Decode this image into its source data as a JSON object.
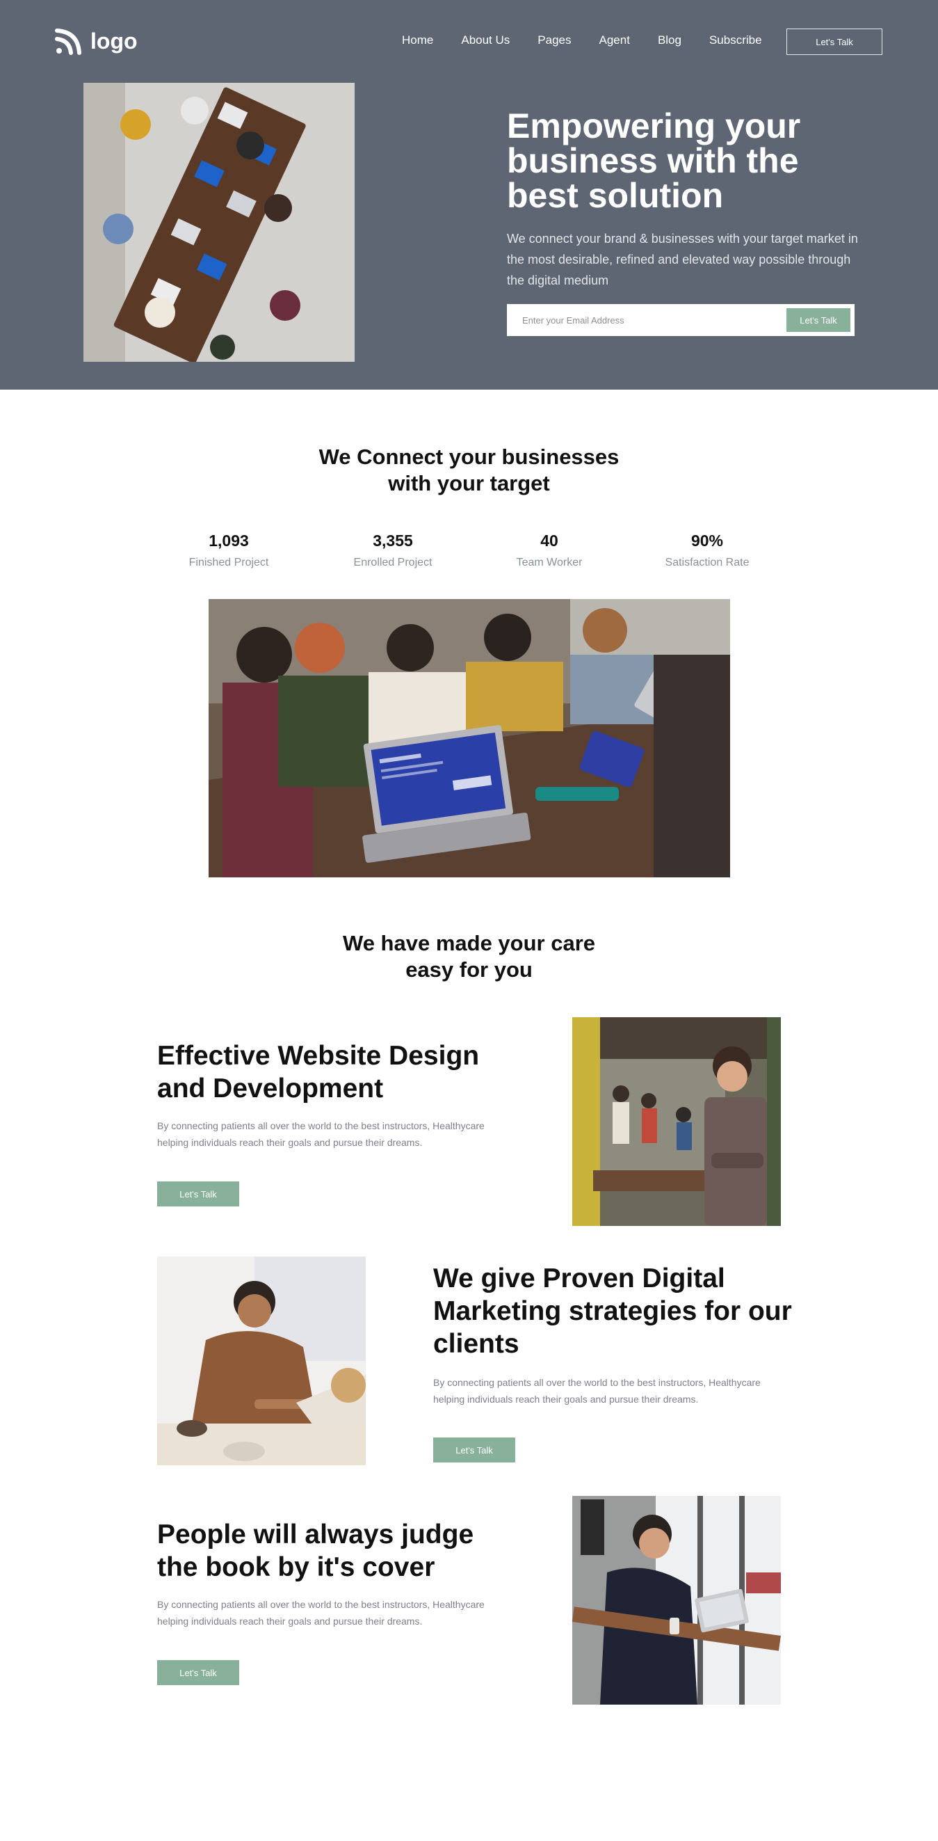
{
  "header": {
    "logo_text": "logo",
    "nav": [
      "Home",
      "About Us",
      "Pages",
      "Agent",
      "Blog",
      "Subscribe"
    ],
    "cta_label": "Let's Talk"
  },
  "hero": {
    "title": "Empowering your business with the best solution",
    "description": "We connect your brand & businesses with your target market in the most desirable, refined and elevated way possible through the digital medium",
    "email_placeholder": "Enter your Email Address",
    "submit_label": "Let's Talk"
  },
  "connect": {
    "title_line1": "We Connect your businesses",
    "title_line2": "with your target",
    "stats": [
      {
        "value": "1,093",
        "label": "Finished Project"
      },
      {
        "value": "3,355",
        "label": "Enrolled Project"
      },
      {
        "value": "40",
        "label": "Team Worker"
      },
      {
        "value": "90%",
        "label": "Satisfaction Rate"
      }
    ]
  },
  "care": {
    "title_line1": "We have made your care",
    "title_line2": "easy for you"
  },
  "features": [
    {
      "title": "Effective Website Design and Development",
      "description": "By connecting patients all over the world to the best instructors, Healthycare helping individuals reach their goals and pursue their dreams.",
      "button_label": "Let's Talk"
    },
    {
      "title": "We give Proven Digital Marketing strategies for our clients",
      "description": "By connecting patients all over the world to the best instructors, Healthycare helping individuals reach their goals and pursue their dreams.",
      "button_label": "Let's Talk"
    },
    {
      "title": "People will always judge the book by it's cover",
      "description": "By connecting patients all over the world to the best instructors, Healthycare helping individuals reach their goals and pursue their dreams.",
      "button_label": "Let's Talk"
    }
  ],
  "colors": {
    "hero_bg": "#5e6673",
    "accent": "#88b09a",
    "muted_text": "#7c818a"
  }
}
